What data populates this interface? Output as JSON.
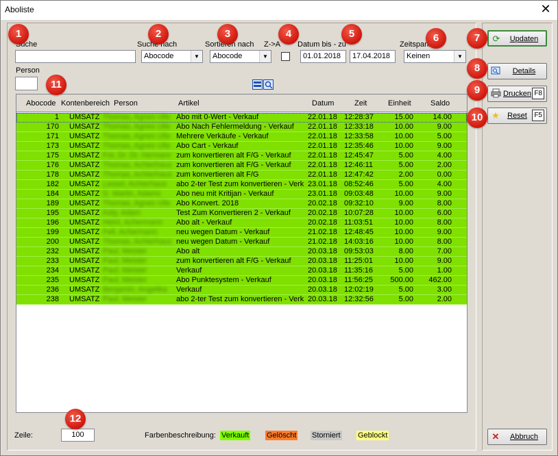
{
  "window": {
    "title": "Aboliste",
    "close_symbol": "✕"
  },
  "badges": [
    "1",
    "2",
    "3",
    "4",
    "5",
    "6",
    "7",
    "8",
    "9",
    "10",
    "11",
    "12"
  ],
  "filters": {
    "search_label": "Suche",
    "search_value": "",
    "search_by_label": "Suche nach",
    "search_by_value": "Abocode",
    "sort_by_label": "Sortieren nach",
    "sort_by_value": "Abocode",
    "desc_label": "Z->A",
    "date_label": "Datum bis - zu",
    "date_from": "01.01.2018",
    "date_to": "17.04.2018",
    "period_label": "Zeitspanne",
    "period_value": "Keinen",
    "person_label": "Person",
    "person_value": ""
  },
  "grid": {
    "columns": [
      "Abocode",
      "Kontenbereich",
      "Person",
      "Artikel",
      "Datum",
      "Zeit",
      "Einheit",
      "Saldo"
    ],
    "rows": [
      {
        "id": "1",
        "kb": "UMSATZ",
        "p": "Thomas, Agnes Ulle",
        "ar": "Abo mit 0-Wert - Verkauf",
        "dt": "22.01.18",
        "tm": "12:28:37",
        "eh": "15.00",
        "sd": "14.00"
      },
      {
        "id": "170",
        "kb": "UMSATZ",
        "p": "Thomas, Agnes Ulle",
        "ar": "Abo Nach Fehlermeldung - Verkauf",
        "dt": "22.01.18",
        "tm": "12:33:18",
        "eh": "10.00",
        "sd": "9.00"
      },
      {
        "id": "171",
        "kb": "UMSATZ",
        "p": "Thomas, Agnes Ulle",
        "ar": "Mehrere Verkäufe - Verkauf",
        "dt": "22.01.18",
        "tm": "12:33:58",
        "eh": "10.00",
        "sd": "5.00"
      },
      {
        "id": "173",
        "kb": "UMSATZ",
        "p": "Thomas, Agnes Ulle",
        "ar": "Abo Cart - Verkauf",
        "dt": "22.01.18",
        "tm": "12:35:46",
        "eh": "10.00",
        "sd": "9.00"
      },
      {
        "id": "175",
        "kb": "UMSATZ",
        "p": "Fot, Dr. Dr. Hermann",
        "ar": "zum konvertieren alt F/G - Verkauf",
        "dt": "22.01.18",
        "tm": "12:45:47",
        "eh": "5.00",
        "sd": "4.00"
      },
      {
        "id": "176",
        "kb": "UMSATZ",
        "p": "Thomas, Achterhaus",
        "ar": "zum konvertieren alt F/G - Verkauf",
        "dt": "22.01.18",
        "tm": "12:46:11",
        "eh": "5.00",
        "sd": "2.00"
      },
      {
        "id": "178",
        "kb": "UMSATZ",
        "p": "Thomas, Achterhaus",
        "ar": "zum konvertieren alt F/G",
        "dt": "22.01.18",
        "tm": "12:47:42",
        "eh": "2.00",
        "sd": "0.00"
      },
      {
        "id": "182",
        "kb": "UMSATZ",
        "p": "Lessel, Achterhaus",
        "ar": "abo 2-ter Test zum konvertieren - Verk",
        "dt": "23.01.18",
        "tm": "08:52:46",
        "eh": "5.00",
        "sd": "4.00"
      },
      {
        "id": "184",
        "kb": "UMSATZ",
        "p": "D. Martin, Adams",
        "ar": "Abo neu mit Kritijan - Verkauf",
        "dt": "23.01.18",
        "tm": "09:03:48",
        "eh": "10.00",
        "sd": "9.00"
      },
      {
        "id": "189",
        "kb": "UMSATZ",
        "p": "Thomas, Agnes Ulle",
        "ar": "Abo Konvert. 2018",
        "dt": "20.02.18",
        "tm": "09:32:10",
        "eh": "9.00",
        "sd": "8.00"
      },
      {
        "id": "195",
        "kb": "UMSATZ",
        "p": "Kely, Adam",
        "ar": "Test Zum Konvertieren 2 - Verkauf",
        "dt": "20.02.18",
        "tm": "10:07:28",
        "eh": "10.00",
        "sd": "6.00"
      },
      {
        "id": "196",
        "kb": "UMSATZ",
        "p": "Heinl, Achermann",
        "ar": "Abo alt - Verkauf",
        "dt": "20.02.18",
        "tm": "11:03:51",
        "eh": "10.00",
        "sd": "8.00"
      },
      {
        "id": "199",
        "kb": "UMSATZ",
        "p": "Fell, Achermann",
        "ar": "neu wegen Datum - Verkauf",
        "dt": "21.02.18",
        "tm": "12:48:45",
        "eh": "10.00",
        "sd": "9.00"
      },
      {
        "id": "200",
        "kb": "UMSATZ",
        "p": "Thomas, Achterhaus",
        "ar": "neu wegen Datum - Verkauf",
        "dt": "21.02.18",
        "tm": "14:03:16",
        "eh": "10.00",
        "sd": "8.00"
      },
      {
        "id": "232",
        "kb": "UMSATZ",
        "p": "Paul, Meister",
        "ar": "Abo alt",
        "dt": "20.03.18",
        "tm": "09:53:03",
        "eh": "8.00",
        "sd": "7.00"
      },
      {
        "id": "233",
        "kb": "UMSATZ",
        "p": "Paul, Meister",
        "ar": "zum konvertieren alt F/G - Verkauf",
        "dt": "20.03.18",
        "tm": "11:25:01",
        "eh": "10.00",
        "sd": "9.00"
      },
      {
        "id": "234",
        "kb": "UMSATZ",
        "p": "Paul, Meister",
        "ar": "Verkauf",
        "dt": "20.03.18",
        "tm": "11:35:16",
        "eh": "5.00",
        "sd": "1.00"
      },
      {
        "id": "235",
        "kb": "UMSATZ",
        "p": "Paul, Meister",
        "ar": "Abo Punktesystem - Verkauf",
        "dt": "20.03.18",
        "tm": "11:56:25",
        "eh": "500.00",
        "sd": "462.00"
      },
      {
        "id": "236",
        "kb": "UMSATZ",
        "p": "Benjamin, Angelika",
        "ar": "Verkauf",
        "dt": "20.03.18",
        "tm": "12:02:19",
        "eh": "5.00",
        "sd": "3.00"
      },
      {
        "id": "238",
        "kb": "UMSATZ",
        "p": "Paul, Meister",
        "ar": "abo 2-ter Test zum konvertieren - Verk",
        "dt": "20.03.18",
        "tm": "12:32:56",
        "eh": "5.00",
        "sd": "2.00"
      }
    ]
  },
  "buttons": {
    "update": {
      "label": "Updaten",
      "icon": "refresh-icon"
    },
    "details": {
      "label": "Details",
      "icon": "details-icon"
    },
    "print": {
      "label": "Drucken",
      "key": "F8",
      "icon": "printer-icon"
    },
    "reset": {
      "label": "Reset",
      "key": "F5",
      "icon": "star-icon"
    },
    "cancel": {
      "label": "Abbruch",
      "icon": "close-icon"
    }
  },
  "footer": {
    "row_label": "Zeile:",
    "row_value": "100",
    "legend_label": "Farbenbeschreibung:",
    "legend": [
      {
        "label": "Verkauft",
        "color": "#80ff00"
      },
      {
        "label": "Gelöscht",
        "color": "#ff7c2a"
      },
      {
        "label": "Storniert",
        "color": "#c8c8c8"
      },
      {
        "label": "Geblockt",
        "color": "#ffff80"
      }
    ]
  },
  "colors": {
    "row_sold": "#80e000",
    "badge": "#d0160c"
  }
}
